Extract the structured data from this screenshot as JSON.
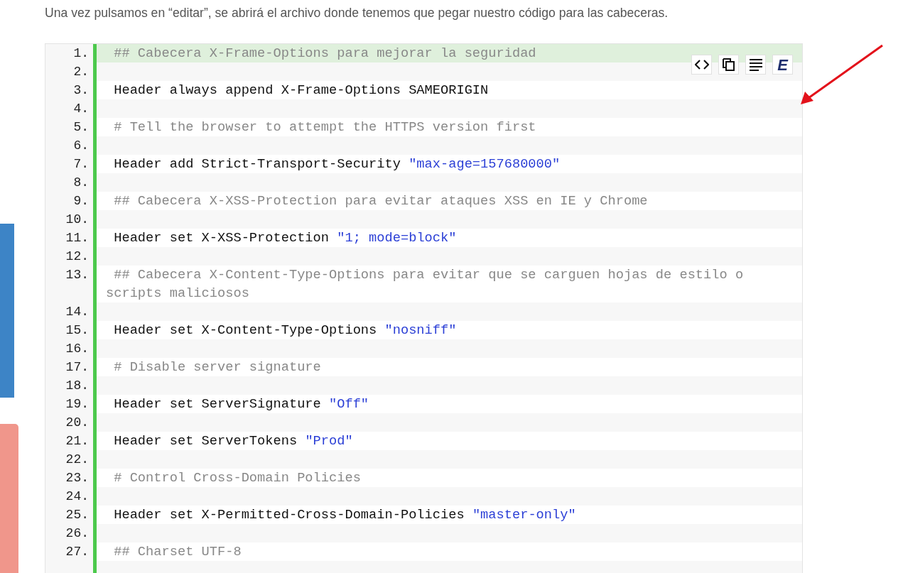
{
  "intro": "Una vez pulsamos en “editar”, se abrirá el archivo donde tenemos que pegar nuestro código para las cabeceras.",
  "toolbar": [
    {
      "kind": "source"
    },
    {
      "kind": "copy"
    },
    {
      "kind": "wrap"
    },
    {
      "kind": "about",
      "label": "E"
    }
  ],
  "code_lines": [
    {
      "number": "1.",
      "highlighted": true,
      "segments": [
        {
          "kind": "comment",
          "text": " ## Cabecera X-Frame-Options para mejorar la seguridad"
        }
      ]
    },
    {
      "number": "2.",
      "highlighted": false
    },
    {
      "number": "3.",
      "highlighted": false,
      "segments": [
        {
          "kind": "plain",
          "text": " Header always append X-Frame-Options SAMEORIGIN"
        }
      ]
    },
    {
      "number": "4.",
      "highlighted": false
    },
    {
      "number": "5.",
      "highlighted": false,
      "segments": [
        {
          "kind": "comment",
          "text": " # Tell the browser to attempt the HTTPS version first"
        }
      ]
    },
    {
      "number": "6.",
      "highlighted": false
    },
    {
      "number": "7.",
      "highlighted": false,
      "segments": [
        {
          "kind": "plain",
          "text": " Header add Strict-Transport-Security "
        },
        {
          "kind": "string",
          "text": "\"max-age=157680000\""
        }
      ]
    },
    {
      "number": "8.",
      "highlighted": false
    },
    {
      "number": "9.",
      "highlighted": false,
      "segments": [
        {
          "kind": "comment",
          "text": " ## Cabecera X-XSS-Protection para evitar ataques XSS en IE y Chrome"
        }
      ]
    },
    {
      "number": "10.",
      "highlighted": false
    },
    {
      "number": "11.",
      "highlighted": false,
      "segments": [
        {
          "kind": "plain",
          "text": " Header set X-XSS-Protection "
        },
        {
          "kind": "string",
          "text": "\"1; mode=block\""
        }
      ]
    },
    {
      "number": "12.",
      "highlighted": false
    },
    {
      "number": "13.",
      "highlighted": false,
      "segments": [
        {
          "kind": "comment",
          "text": " ## Cabecera X-Content-Type-Options para evitar que se carguen hojas de estilo o scripts maliciosos"
        }
      ]
    },
    {
      "number": "14.",
      "highlighted": false
    },
    {
      "number": "15.",
      "highlighted": false,
      "segments": [
        {
          "kind": "plain",
          "text": " Header set X-Content-Type-Options "
        },
        {
          "kind": "string",
          "text": "\"nosniff\""
        }
      ]
    },
    {
      "number": "16.",
      "highlighted": false
    },
    {
      "number": "17.",
      "highlighted": false,
      "segments": [
        {
          "kind": "comment",
          "text": " # Disable server signature"
        }
      ]
    },
    {
      "number": "18.",
      "highlighted": false
    },
    {
      "number": "19.",
      "highlighted": false,
      "segments": [
        {
          "kind": "plain",
          "text": " Header set ServerSignature "
        },
        {
          "kind": "string",
          "text": "\"Off\""
        }
      ]
    },
    {
      "number": "20.",
      "highlighted": false
    },
    {
      "number": "21.",
      "highlighted": false,
      "segments": [
        {
          "kind": "plain",
          "text": " Header set ServerTokens "
        },
        {
          "kind": "string",
          "text": "\"Prod\""
        }
      ]
    },
    {
      "number": "22.",
      "highlighted": false
    },
    {
      "number": "23.",
      "highlighted": false,
      "segments": [
        {
          "kind": "comment",
          "text": " # Control Cross-Domain Policies"
        }
      ]
    },
    {
      "number": "24.",
      "highlighted": false
    },
    {
      "number": "25.",
      "highlighted": false,
      "segments": [
        {
          "kind": "plain",
          "text": " Header set X-Permitted-Cross-Domain-Policies "
        },
        {
          "kind": "string",
          "text": "\"master-only\""
        }
      ]
    },
    {
      "number": "26.",
      "highlighted": false
    },
    {
      "number": "27.",
      "highlighted": false,
      "segments": [
        {
          "kind": "comment",
          "text": " ## Charset UTF-8"
        }
      ]
    }
  ]
}
